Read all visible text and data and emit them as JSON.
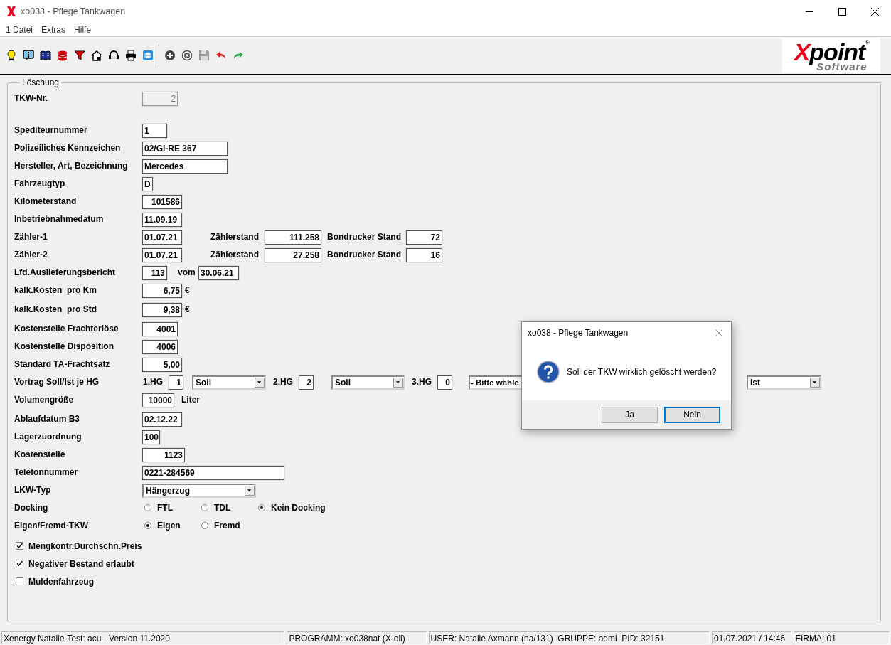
{
  "window": {
    "title": "xo038 - Pflege Tankwagen"
  },
  "menu": [
    "1 Datei",
    "Extras",
    "Hilfe"
  ],
  "logo": {
    "brand": "Xpoint",
    "mark": "®",
    "tagline": "Software"
  },
  "form": {
    "legend": "Löschung",
    "rows": [
      {
        "label": "TKW-Nr.",
        "items": [
          {
            "kind": "field",
            "value": "2",
            "disabled": true
          }
        ]
      },
      {
        "label": "Spediteurnummer",
        "items": [
          {
            "kind": "field",
            "value": "1",
            "disabled": false
          }
        ]
      },
      {
        "label": "Polizeiliches Kennzeichen",
        "items": [
          {
            "kind": "field",
            "value": "02/GI-RE 367",
            "disabled": false
          }
        ]
      },
      {
        "label": "Hersteller, Art, Bezeichnung",
        "items": [
          {
            "kind": "field",
            "value": "Mercedes",
            "disabled": false
          }
        ]
      },
      {
        "label": "Fahrzeugtyp",
        "items": [
          {
            "kind": "field",
            "value": "D",
            "disabled": false
          }
        ]
      },
      {
        "label": "Kilometerstand",
        "items": [
          {
            "kind": "field",
            "value": "101586",
            "disabled": false
          }
        ]
      },
      {
        "label": "Inbetriebnahmedatum",
        "items": [
          {
            "kind": "field",
            "value": "11.09.19",
            "disabled": false
          }
        ]
      },
      {
        "label": "Zähler-1",
        "items": [
          {
            "kind": "field",
            "value": "01.07.21",
            "disabled": false
          },
          {
            "kind": "text",
            "text": "Zählerstand"
          },
          {
            "kind": "field",
            "value": "111.258",
            "disabled": false
          },
          {
            "kind": "text",
            "text": "Bondrucker Stand"
          },
          {
            "kind": "field",
            "value": "72",
            "disabled": false
          }
        ]
      },
      {
        "label": "Zähler-2",
        "items": [
          {
            "kind": "field",
            "value": "01.07.21",
            "disabled": false
          },
          {
            "kind": "text",
            "text": "Zählerstand"
          },
          {
            "kind": "field",
            "value": "27.258",
            "disabled": false
          },
          {
            "kind": "text",
            "text": "Bondrucker Stand"
          },
          {
            "kind": "field",
            "value": "16",
            "disabled": false
          }
        ]
      },
      {
        "label": "Lfd.Auslieferungsbericht",
        "items": [
          {
            "kind": "field",
            "value": "113",
            "disabled": false
          },
          {
            "kind": "text",
            "text": "vom"
          },
          {
            "kind": "field",
            "value": "30.06.21",
            "disabled": false
          }
        ]
      },
      {
        "label": "kalk.Kosten  pro Km",
        "items": [
          {
            "kind": "field",
            "value": "6,75",
            "disabled": false
          },
          {
            "kind": "text",
            "text": "€"
          }
        ]
      },
      {
        "label": "kalk.Kosten  pro Std",
        "items": [
          {
            "kind": "field",
            "value": "9,38",
            "disabled": false
          },
          {
            "kind": "text",
            "text": "€"
          }
        ]
      },
      {
        "label": "Kostenstelle Frachterlöse",
        "items": [
          {
            "kind": "field",
            "value": "4001",
            "disabled": false
          }
        ]
      },
      {
        "label": "Kostenstelle Disposition",
        "items": [
          {
            "kind": "field",
            "value": "4006",
            "disabled": false
          }
        ]
      },
      {
        "label": "Standard TA-Frachtsatz",
        "items": [
          {
            "kind": "field",
            "value": "5,00",
            "disabled": false
          }
        ]
      },
      {
        "label": "Vortrag Soll/Ist je HG",
        "items": [
          {
            "kind": "text",
            "text": "1.HG"
          },
          {
            "kind": "field",
            "value": "1",
            "disabled": false
          },
          {
            "kind": "dropdown",
            "value": "Soll"
          },
          {
            "kind": "text",
            "text": "2.HG"
          },
          {
            "kind": "field",
            "value": "2",
            "disabled": false
          },
          {
            "kind": "dropdown",
            "value": "Soll"
          },
          {
            "kind": "text",
            "text": "3.HG"
          },
          {
            "kind": "field",
            "value": "0",
            "disabled": false
          },
          {
            "kind": "dropdown",
            "value": "- Bitte wähle"
          },
          {
            "kind": "dropdown",
            "value": "Ist"
          }
        ]
      },
      {
        "label": "Volumengröße",
        "items": [
          {
            "kind": "field",
            "value": "10000",
            "disabled": false
          },
          {
            "kind": "text",
            "text": "Liter"
          }
        ]
      },
      {
        "label": "Ablaufdatum B3",
        "items": [
          {
            "kind": "field",
            "value": "02.12.22",
            "disabled": false
          }
        ]
      },
      {
        "label": "Lagerzuordnung",
        "items": [
          {
            "kind": "field",
            "value": "100",
            "disabled": false
          }
        ]
      },
      {
        "label": "Kostenstelle",
        "items": [
          {
            "kind": "field",
            "value": "1123",
            "disabled": false
          }
        ]
      },
      {
        "label": "Telefonnummer",
        "items": [
          {
            "kind": "field",
            "value": "0221-284569",
            "disabled": false
          }
        ]
      },
      {
        "label": "LKW-Typ",
        "items": [
          {
            "kind": "dropdown",
            "value": "Hängerzug"
          }
        ]
      },
      {
        "label": "Docking",
        "items": [
          {
            "kind": "radio",
            "label": "FTL",
            "selected": false
          },
          {
            "kind": "radio",
            "label": "TDL",
            "selected": false
          },
          {
            "kind": "radio",
            "label": "Kein Docking",
            "selected": true
          }
        ]
      },
      {
        "label": "Eigen/Fremd-TKW",
        "items": [
          {
            "kind": "radio",
            "label": "Eigen",
            "selected": true
          },
          {
            "kind": "radio",
            "label": "Fremd",
            "selected": false
          }
        ]
      }
    ],
    "options": [
      {
        "label": "Mengkontr.Durchschn.Preis",
        "checked": true
      },
      {
        "label": "Negativer Bestand erlaubt",
        "checked": true
      },
      {
        "label": "Muldenfahrzeug",
        "checked": false
      }
    ]
  },
  "dialog": {
    "title": "xo038 - Pflege Tankwagen",
    "message": "Soll der TKW wirklich gelöscht werden?",
    "buttons": [
      {
        "label": "Ja",
        "focused": false
      },
      {
        "label": "Nein",
        "focused": true
      }
    ]
  },
  "status_bar": [
    "Xenergy Natalie-Test: acu - Version 11.2020",
    "PROGRAMM: xo038nat (X-oil)",
    "USER: Natalie Axmann (na/131)  GRUPPE: admi  PID: 32151",
    "01.07.2021 / 14:46",
    "FIRMA: 01"
  ]
}
